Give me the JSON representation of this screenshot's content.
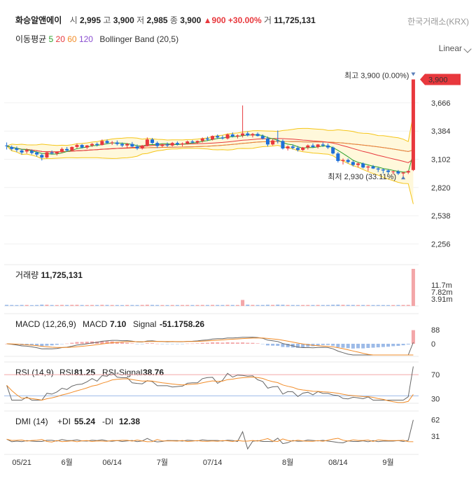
{
  "header": {
    "name": "화승알앤에이",
    "open_label": "시",
    "open": "2,995",
    "high_label": "고",
    "high": "3,900",
    "low_label": "저",
    "low": "2,985",
    "close_label": "종",
    "close": "3,900",
    "change": "900",
    "change_pct": "+30.00%",
    "volume_label": "거",
    "volume": "11,725,131",
    "exchange": "한국거래소(KRX)"
  },
  "overlays": {
    "ma_label": "이동평균",
    "ma5": "5",
    "ma20": "20",
    "ma60": "60",
    "ma120": "120",
    "bollinger": "Bollinger Band (20,5)",
    "scale": "Linear"
  },
  "colors": {
    "up": "#e8383d",
    "down": "#1e6fd9",
    "ma5": "#2ca02c",
    "ma20": "#e8383d",
    "ma60": "#f28c28",
    "ma120": "#8b4fd1",
    "band_fill": "#fff8db",
    "band_line": "#f5c518"
  },
  "chart_data": {
    "type": "candlestick",
    "y_ticks": [
      "3,666",
      "3,384",
      "3,102",
      "2,820",
      "2,538",
      "2,256"
    ],
    "ylim": [
      2140,
      4050
    ],
    "x_ticks": [
      "05/21",
      "6월",
      "06/14",
      "7월",
      "07/14",
      "8월",
      "08/14",
      "9월"
    ],
    "max_annotation": "최고 3,900 (0.00%)",
    "min_annotation": "최저 2,930 (33.11%)",
    "last_price_label": "3,900",
    "candles": [
      [
        3240,
        3270,
        3200,
        3235
      ],
      [
        3225,
        3240,
        3190,
        3205
      ],
      [
        3210,
        3230,
        3175,
        3195
      ],
      [
        3190,
        3205,
        3150,
        3170
      ],
      [
        3180,
        3210,
        3160,
        3195
      ],
      [
        3185,
        3200,
        3150,
        3165
      ],
      [
        3170,
        3180,
        3130,
        3150
      ],
      [
        3145,
        3160,
        3090,
        3120
      ],
      [
        3120,
        3175,
        3110,
        3170
      ],
      [
        3170,
        3190,
        3150,
        3160
      ],
      [
        3160,
        3180,
        3140,
        3175
      ],
      [
        3175,
        3220,
        3165,
        3205
      ],
      [
        3205,
        3225,
        3180,
        3190
      ],
      [
        3190,
        3230,
        3180,
        3225
      ],
      [
        3225,
        3260,
        3210,
        3245
      ],
      [
        3245,
        3255,
        3210,
        3220
      ],
      [
        3220,
        3245,
        3205,
        3240
      ],
      [
        3240,
        3265,
        3225,
        3255
      ],
      [
        3255,
        3270,
        3230,
        3245
      ],
      [
        3245,
        3300,
        3240,
        3285
      ],
      [
        3285,
        3300,
        3255,
        3265
      ],
      [
        3265,
        3285,
        3245,
        3270
      ],
      [
        3270,
        3290,
        3240,
        3255
      ],
      [
        3255,
        3270,
        3225,
        3240
      ],
      [
        3240,
        3265,
        3210,
        3255
      ],
      [
        3255,
        3275,
        3220,
        3230
      ],
      [
        3230,
        3250,
        3195,
        3210
      ],
      [
        3210,
        3245,
        3200,
        3240
      ],
      [
        3240,
        3320,
        3230,
        3300
      ],
      [
        3300,
        3315,
        3255,
        3265
      ],
      [
        3265,
        3280,
        3215,
        3235
      ],
      [
        3235,
        3260,
        3220,
        3250
      ],
      [
        3250,
        3270,
        3225,
        3240
      ],
      [
        3240,
        3275,
        3230,
        3265
      ],
      [
        3265,
        3280,
        3240,
        3250
      ],
      [
        3250,
        3270,
        3230,
        3260
      ],
      [
        3260,
        3290,
        3250,
        3280
      ],
      [
        3280,
        3295,
        3260,
        3270
      ],
      [
        3270,
        3290,
        3255,
        3285
      ],
      [
        3285,
        3320,
        3270,
        3310
      ],
      [
        3310,
        3330,
        3285,
        3300
      ],
      [
        3300,
        3340,
        3290,
        3335
      ],
      [
        3335,
        3350,
        3305,
        3320
      ],
      [
        3320,
        3340,
        3300,
        3310
      ],
      [
        3310,
        3360,
        3300,
        3350
      ],
      [
        3350,
        3370,
        3320,
        3330
      ],
      [
        3330,
        3350,
        3310,
        3340
      ],
      [
        3340,
        3640,
        3320,
        3360
      ],
      [
        3360,
        3380,
        3330,
        3340
      ],
      [
        3340,
        3365,
        3320,
        3355
      ],
      [
        3355,
        3370,
        3330,
        3335
      ],
      [
        3335,
        3350,
        3300,
        3310
      ],
      [
        3310,
        3330,
        3230,
        3250
      ],
      [
        3250,
        3305,
        3240,
        3290
      ],
      [
        3290,
        3390,
        3260,
        3285
      ],
      [
        3285,
        3300,
        3200,
        3210
      ],
      [
        3210,
        3240,
        3190,
        3230
      ],
      [
        3230,
        3250,
        3200,
        3215
      ],
      [
        3215,
        3235,
        3180,
        3195
      ],
      [
        3195,
        3225,
        3185,
        3220
      ],
      [
        3220,
        3250,
        3200,
        3240
      ],
      [
        3240,
        3260,
        3215,
        3225
      ],
      [
        3225,
        3255,
        3210,
        3250
      ],
      [
        3250,
        3270,
        3225,
        3240
      ],
      [
        3240,
        3260,
        3205,
        3220
      ],
      [
        3220,
        3230,
        3150,
        3160
      ],
      [
        3160,
        3175,
        3070,
        3085
      ],
      [
        3085,
        3110,
        3050,
        3095
      ],
      [
        3095,
        3110,
        3060,
        3075
      ],
      [
        3075,
        3090,
        3030,
        3045
      ],
      [
        3045,
        3070,
        3020,
        3060
      ],
      [
        3060,
        3070,
        3010,
        3020
      ],
      [
        3020,
        3040,
        2985,
        3030
      ],
      [
        3030,
        3045,
        3005,
        3010
      ],
      [
        3010,
        3020,
        2975,
        3000
      ],
      [
        3000,
        3010,
        2960,
        2990
      ],
      [
        2990,
        3000,
        2955,
        2975
      ],
      [
        2975,
        2990,
        2950,
        2980
      ],
      [
        2980,
        2995,
        2945,
        2960
      ],
      [
        2960,
        2975,
        2930,
        2970
      ],
      [
        2970,
        2990,
        2955,
        2985
      ],
      [
        2995,
        3900,
        2985,
        3900
      ]
    ],
    "volume": {
      "label": "거래량",
      "value": "11,725,131",
      "ticks": [
        "11.7m",
        "7.82m",
        "3.91m"
      ],
      "ylim": [
        0,
        11725131
      ],
      "values": [
        350000,
        300000,
        280000,
        320000,
        310000,
        260000,
        300000,
        420000,
        380000,
        300000,
        290000,
        330000,
        310000,
        340000,
        360000,
        300000,
        290000,
        310000,
        300000,
        350000,
        320000,
        300000,
        290000,
        280000,
        310000,
        300000,
        290000,
        320000,
        380000,
        330000,
        300000,
        290000,
        280000,
        300000,
        290000,
        300000,
        310000,
        290000,
        300000,
        320000,
        300000,
        330000,
        310000,
        300000,
        340000,
        310000,
        300000,
        1900000,
        420000,
        330000,
        300000,
        310000,
        380000,
        330000,
        420000,
        380000,
        310000,
        300000,
        290000,
        300000,
        310000,
        300000,
        320000,
        300000,
        310000,
        380000,
        420000,
        350000,
        330000,
        320000,
        300000,
        310000,
        300000,
        290000,
        300000,
        290000,
        280000,
        290000,
        300000,
        310000,
        330000,
        11725131
      ]
    },
    "macd": {
      "label": "MACD (12,26,9)",
      "macd_label": "MACD",
      "macd_value": "7.10",
      "signal_label": "Signal",
      "signal_value": "-51.1758.26",
      "ticks": [
        "88",
        "0"
      ],
      "ylim": [
        -120,
        120
      ]
    },
    "rsi": {
      "label": "RSI (14,9)",
      "rsi_label": "RSI",
      "rsi_value": "81.25",
      "signal_label": "RSI-Signal",
      "signal_value": "38.76",
      "ticks": [
        "70",
        "30"
      ],
      "ylim": [
        20,
        90
      ]
    },
    "dmi": {
      "label": "DMI (14)",
      "pdi_label": "+DI",
      "pdi_value": "55.24",
      "mdi_label": "-DI",
      "mdi_value": "12.38",
      "ticks": [
        "62",
        "31"
      ],
      "ylim": [
        0,
        75
      ]
    }
  }
}
